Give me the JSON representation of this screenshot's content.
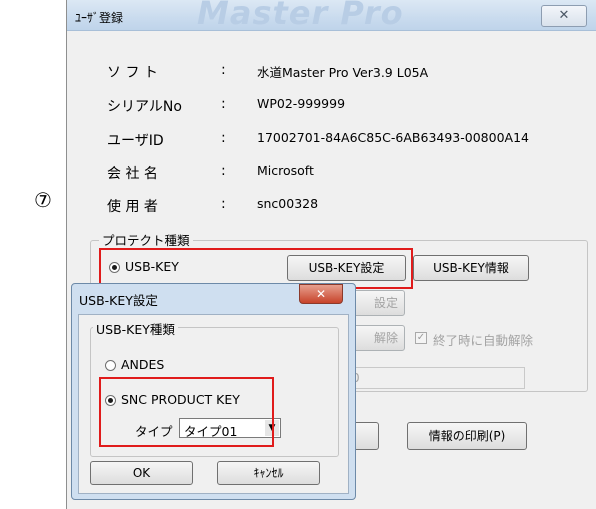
{
  "step_marker": "⑦",
  "main": {
    "title": "ﾕｰｻﾞ登録",
    "watermark": "Master Pro",
    "close": "✕",
    "rows": [
      {
        "label": "ソ フ ト",
        "colon": ":",
        "value": "水道Master Pro Ver3.9 L05A"
      },
      {
        "label": "シリアルNo",
        "colon": ":",
        "value": "WP02-999999"
      },
      {
        "label": "ユーザID",
        "colon": ":",
        "value": "17002701-84A6C85C-6AB63493-00800A14"
      },
      {
        "label": "会 社 名",
        "colon": ":",
        "value": "Microsoft"
      },
      {
        "label": "使 用 者",
        "colon": ":",
        "value": "snc00328"
      }
    ],
    "protect_group": {
      "title": "プロテクト種類",
      "usb_key_label": "USB-KEY",
      "usb_key_selected": true,
      "usb_key_setting_button": "USB-KEY設定",
      "usb_key_info_button": "USB-KEY情報",
      "partial_setting_button": "設定",
      "partial_release_button": "解除",
      "auto_release_label": "終了時に自動解除",
      "auto_release_checked": true,
      "partial_field_text": "0"
    },
    "print_button": "情報の印刷(P)"
  },
  "sub_dialog": {
    "title": "USB-KEY設定",
    "close": "✕",
    "group_title": "USB-KEY種類",
    "options": [
      {
        "label": "ANDES",
        "selected": false
      },
      {
        "label": "SNC PRODUCT KEY",
        "selected": true
      }
    ],
    "type_label": "タイプ",
    "type_value": "タイプ01",
    "ok_button": "OK",
    "cancel_button": "ｷｬﾝｾﾙ"
  }
}
